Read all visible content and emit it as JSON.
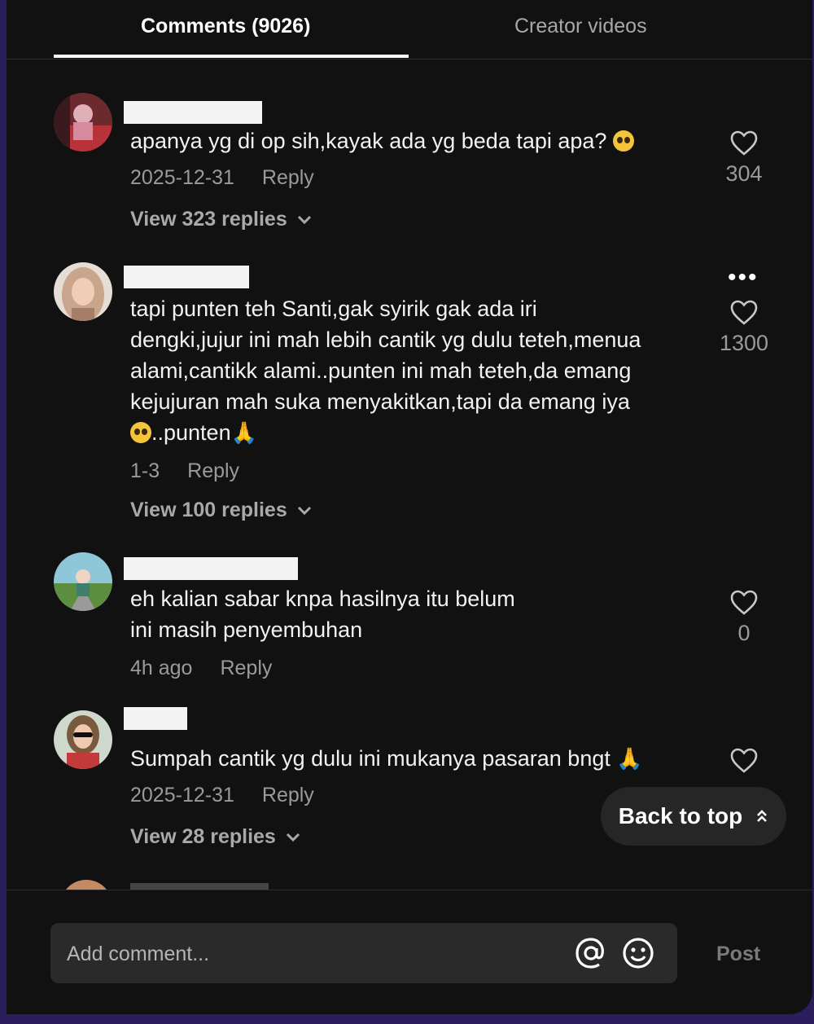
{
  "tabs": [
    {
      "label": "Comments (9026)",
      "active": true
    },
    {
      "label": "Creator videos",
      "active": false
    }
  ],
  "comments": [
    {
      "text": "apanya yg di op sih,kayak ada yg beda tapi apa?",
      "date": "2025-12-31",
      "reply_label": "Reply",
      "likes": "304",
      "view_replies": "View 323 replies"
    },
    {
      "text_main": "tapi punten teh Santi,gak syirik gak ada iri\ndengki,jujur ini mah lebih cantik yg dulu teteh,menua\nalami,cantikk alami..punten ini mah teteh,da emang\nkejujuran mah suka menyakitkan,tapi da emang iya\n",
      "text_tail": "..punten",
      "date": "1-3",
      "reply_label": "Reply",
      "likes": "1300",
      "view_replies": "View 100 replies"
    },
    {
      "text": "eh kalian sabar knpa hasilnya itu belum\nini masih penyembuhan",
      "date": "4h ago",
      "reply_label": "Reply",
      "likes": "0"
    },
    {
      "text": "Sumpah cantik yg dulu ini mukanya pasaran bngt",
      "date": "2025-12-31",
      "reply_label": "Reply",
      "view_replies": "View 28 replies"
    }
  ],
  "back_to_top": "Back to top",
  "footer": {
    "placeholder": "Add comment...",
    "post_label": "Post"
  },
  "colors": {
    "background": "#111111",
    "text": "#f2f2f2",
    "muted": "#9a9a9a"
  }
}
